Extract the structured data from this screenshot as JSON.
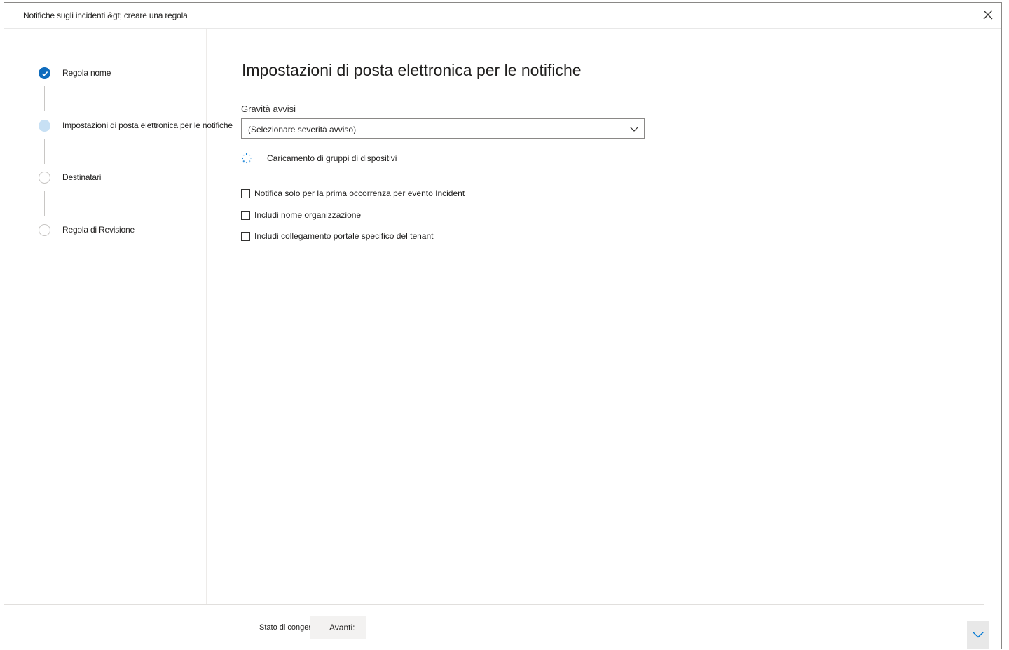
{
  "window": {
    "title": "Notifiche sugli incidenti &gt; creare una regola",
    "close_icon": "close-icon"
  },
  "steps": [
    {
      "label": "Regola nome",
      "state": "completed"
    },
    {
      "label": "Impostazioni di posta elettronica per le notifiche",
      "state": "current"
    },
    {
      "label": "Destinatari",
      "state": "pending"
    },
    {
      "label": "Regola di Revisione",
      "state": "pending"
    }
  ],
  "main": {
    "title": "Impostazioni di posta elettronica per le notifiche",
    "severity_label": "Gravità avvisi",
    "severity_value": "(Selezionare severità avviso)",
    "loading_text": "Caricamento di gruppi di dispositivi",
    "checkboxes": [
      {
        "label": "Notifica solo per la prima occorrenza per evento Incident",
        "checked": false
      },
      {
        "label": "Includi nome organizzazione",
        "checked": false
      },
      {
        "label": "Includi collegamento portale specifico del tenant",
        "checked": false
      }
    ]
  },
  "footer": {
    "status_text": "Stato di congestione",
    "next_label": "Avanti:"
  },
  "colors": {
    "accent": "#0f6cbd",
    "current_step": "#c7e0f4",
    "spinner": "#0078d4"
  }
}
